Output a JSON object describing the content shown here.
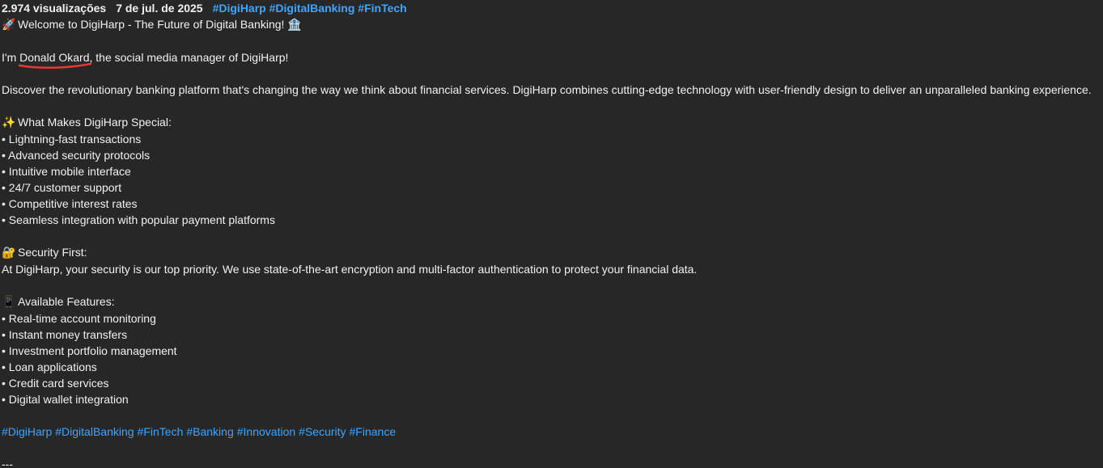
{
  "meta": {
    "views": "2.974 visualizações",
    "date": "7 de jul. de 2025",
    "hashtags": [
      "#DigiHarp",
      "#DigitalBanking",
      "#FinTech"
    ]
  },
  "intro": {
    "welcome_icon": "rocket-icon",
    "welcome_text": "Welcome to DigiHarp - The Future of Digital Banking!",
    "bank_icon": "bank-icon",
    "manager_prefix": "I'm ",
    "manager_name": "Donald Okard",
    "manager_suffix": ", the social media manager of DigiHarp!",
    "discover": "Discover the revolutionary banking platform that's changing the way we think about financial services. DigiHarp combines cutting-edge technology with user-friendly design to deliver an unparalleled banking experience."
  },
  "special": {
    "icon": "sparkles-icon",
    "heading": "What Makes DigiHarp Special:",
    "items": [
      "Lightning-fast transactions",
      "Advanced security protocols",
      "Intuitive mobile interface",
      "24/7 customer support",
      "Competitive interest rates",
      "Seamless integration with popular payment platforms"
    ]
  },
  "security": {
    "icon": "lock-key-icon",
    "heading": "Security First:",
    "text": "At DigiHarp, your security is our top priority. We use state-of-the-art encryption and multi-factor authentication to protect your financial data."
  },
  "features": {
    "icon": "mobile-phone-icon",
    "heading": "Available Features:",
    "items": [
      "Real-time account monitoring",
      "Instant money transfers",
      "Investment portfolio management",
      "Loan applications",
      "Credit card services",
      "Digital wallet integration"
    ]
  },
  "footer_tags": [
    "#DigiHarp",
    "#DigitalBanking",
    "#FinTech",
    "#Banking",
    "#Innovation",
    "#Security",
    "#Finance"
  ],
  "separator": "---",
  "colors": {
    "background": "#272727",
    "text": "#f1f1f1",
    "link": "#3ea6ff",
    "annotation": "#e53935"
  }
}
